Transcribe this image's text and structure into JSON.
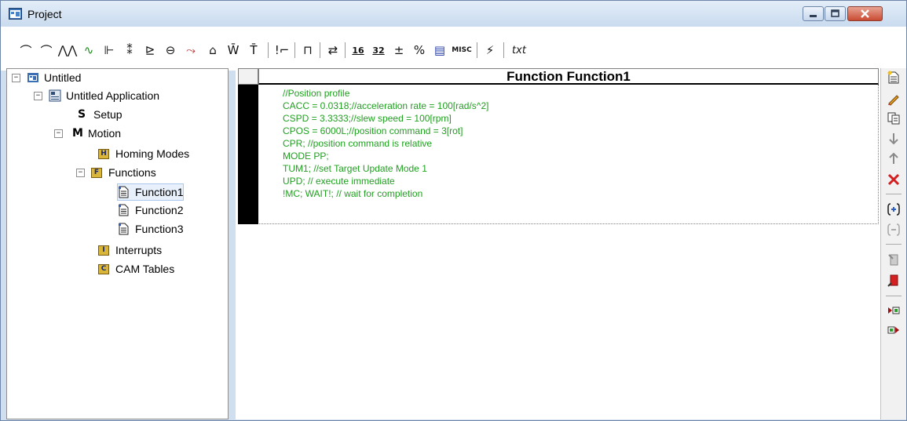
{
  "window": {
    "title": "Project"
  },
  "toolbar": {
    "groups": [
      [
        "⌒",
        "⌒",
        "⋀⋀",
        "∿",
        "⊩",
        "⁑",
        "⊵",
        "⊖",
        "⤳",
        "⌂",
        "W̄",
        "T̄"
      ],
      [
        "!⌐"
      ],
      [
        "⊓"
      ],
      [
        "⇄"
      ],
      [
        "16",
        "32",
        "±",
        "%",
        "▤",
        "MISC"
      ],
      [
        "⚡"
      ],
      [
        "txt"
      ]
    ]
  },
  "tree": {
    "root": "Untitled",
    "application": "Untitled Application",
    "setup_letter": "S",
    "setup": "Setup",
    "motion_letter": "M",
    "motion": "Motion",
    "homing_badge": "H",
    "homing": "Homing Modes",
    "functions_badge": "F",
    "functions": "Functions",
    "function_items": [
      "Function1",
      "Function2",
      "Function3"
    ],
    "interrupts_badge": "I",
    "interrupts": "Interrupts",
    "cam_badge": "C",
    "cam": "CAM Tables",
    "expander_open": "−"
  },
  "editor": {
    "title": "Function Function1",
    "lines": [
      "//Position profile",
      "CACC = 0.0318;//acceleration rate = 100[rad/s^2]",
      "CSPD = 3.3333;//slew speed = 100[rpm]",
      "CPOS = 6000L;//position command = 3[rot]",
      "CPR; //position command is relative",
      "MODE PP;",
      "TUM1; //set Target Update Mode 1",
      "UPD; // execute immediate",
      "!MC; WAIT!; // wait for completion"
    ],
    "code_color": "#1fa01f"
  },
  "side_toolbar": {
    "icons": [
      "new-function-icon",
      "edit-icon",
      "duplicate-icon",
      "move-down-icon",
      "move-up-icon",
      "delete-icon",
      "insert-call-icon",
      "remove-call-icon",
      "disabled-icon",
      "red-doc-icon",
      "play-left-icon",
      "play-right-icon"
    ]
  }
}
